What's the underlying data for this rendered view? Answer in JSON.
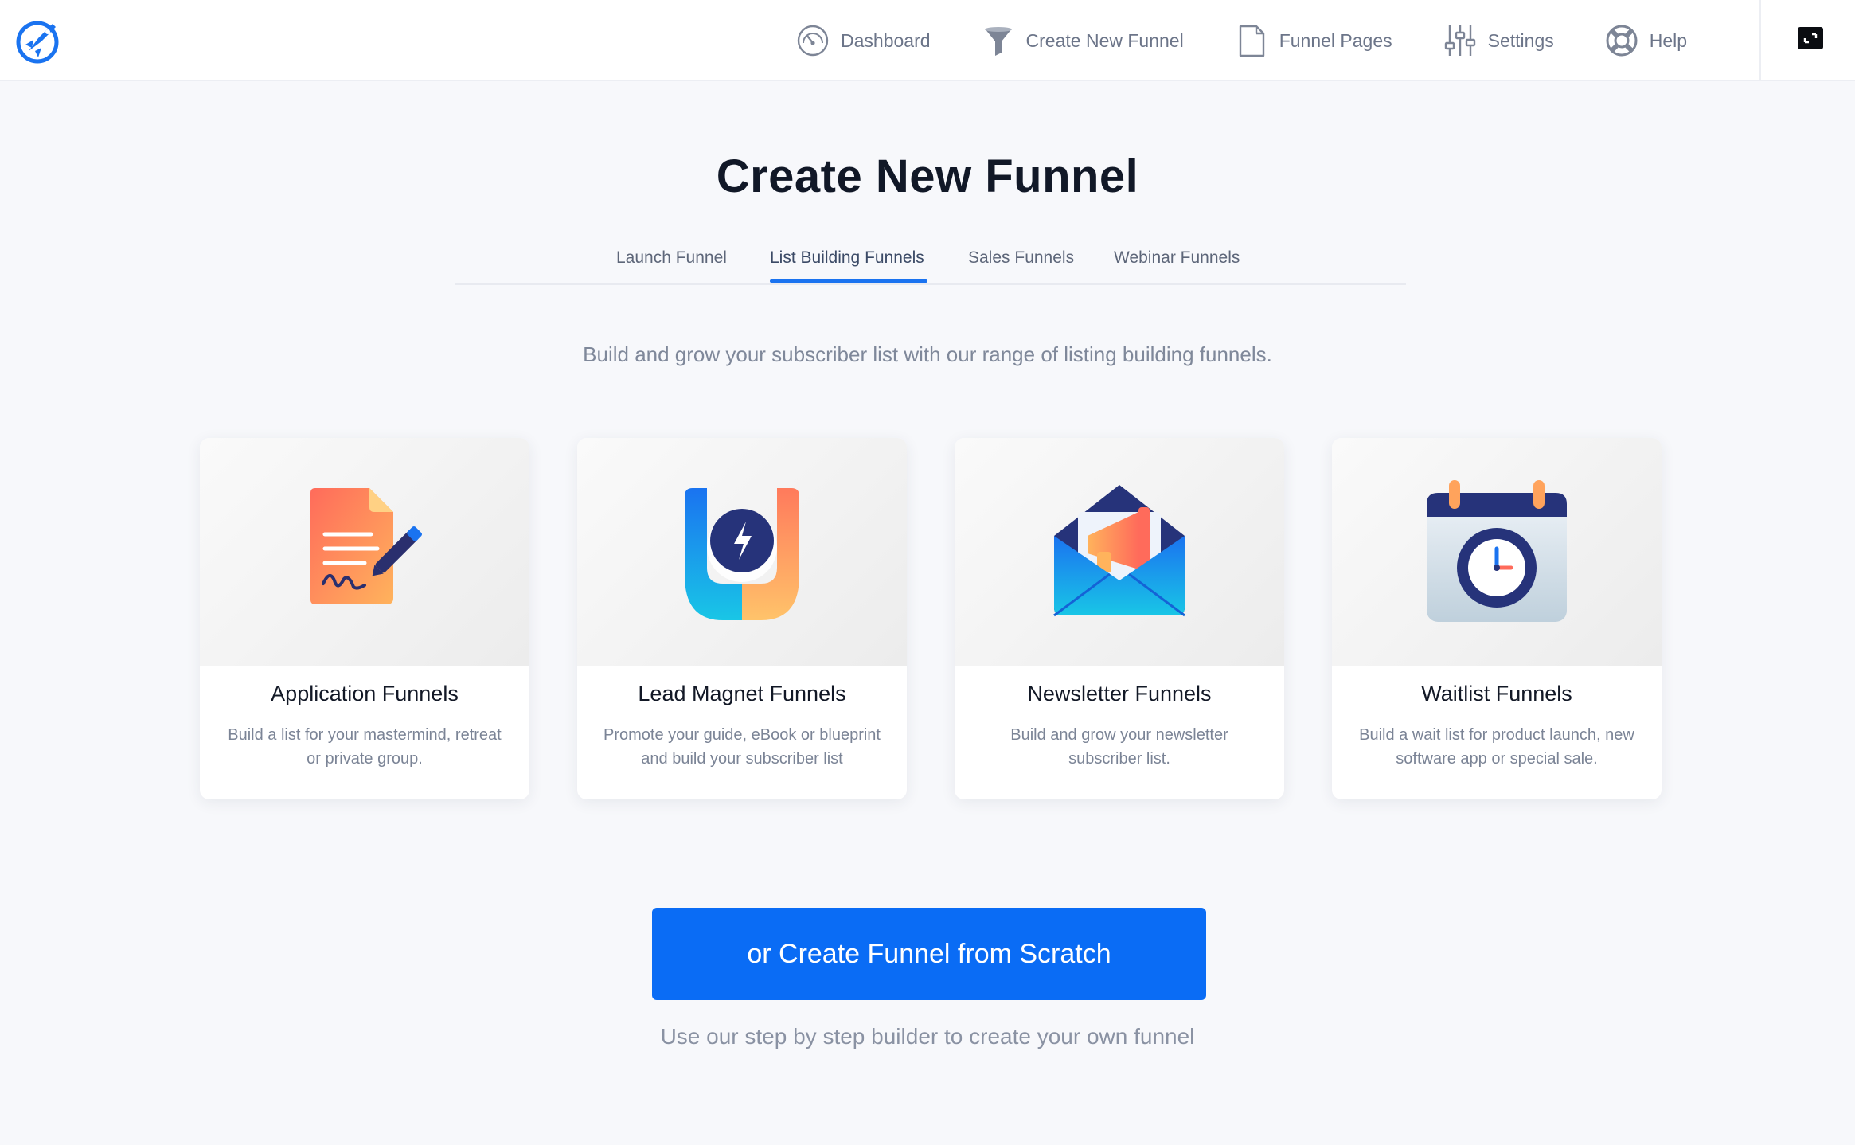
{
  "nav": {
    "items": [
      {
        "label": "Dashboard",
        "icon": "dashboard-gauge-icon"
      },
      {
        "label": "Create New Funnel",
        "icon": "funnel-icon"
      },
      {
        "label": "Funnel Pages",
        "icon": "page-icon"
      },
      {
        "label": "Settings",
        "icon": "sliders-icon"
      },
      {
        "label": "Help",
        "icon": "lifebuoy-icon"
      }
    ]
  },
  "page": {
    "title": "Create New Funnel",
    "subtitle": "Build and grow your subscriber list with our range of listing building funnels."
  },
  "tabs": [
    {
      "label": "Launch Funnel",
      "active": false
    },
    {
      "label": "List Building Funnels",
      "active": true
    },
    {
      "label": "Sales Funnels",
      "active": false
    },
    {
      "label": "Webinar Funnels",
      "active": false
    }
  ],
  "cards": [
    {
      "title": "Application Funnels",
      "description": "Build a list for your mastermind, retreat or private group.",
      "icon": "signed-document-icon"
    },
    {
      "title": "Lead Magnet Funnels",
      "description": "Promote your guide, eBook or blueprint and build your subscriber list",
      "icon": "magnet-icon"
    },
    {
      "title": "Newsletter Funnels",
      "description": "Build and grow your newsletter subscriber list.",
      "icon": "envelope-megaphone-icon"
    },
    {
      "title": "Waitlist Funnels",
      "description": "Build a wait list for product launch, new software app or special sale.",
      "icon": "calendar-clock-icon"
    }
  ],
  "cta": {
    "label": "or Create Funnel from Scratch",
    "note": "Use our step by step builder to create your own funnel"
  },
  "colors": {
    "accent": "#0a6cf5",
    "background": "#f7f8fb"
  }
}
